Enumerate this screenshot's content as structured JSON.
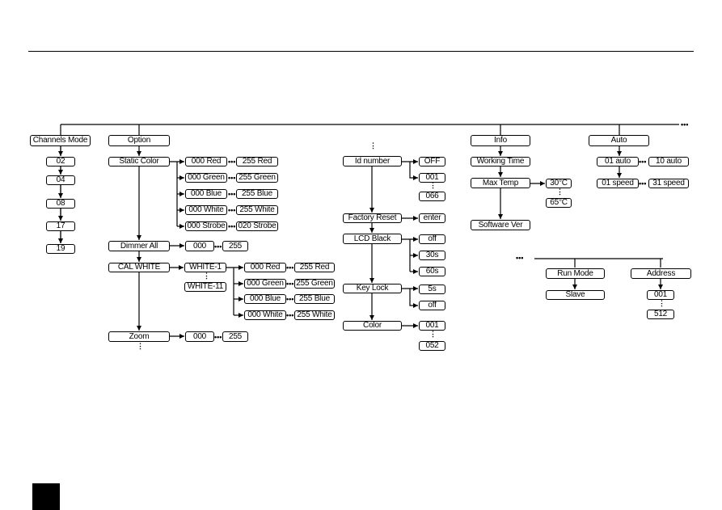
{
  "menu": {
    "channels_mode": {
      "label": "Channels Mode",
      "values": [
        "02",
        "04",
        "08",
        "17",
        "19"
      ]
    },
    "option": {
      "label": "Option",
      "static_color": {
        "label": "Static Color",
        "ranges": [
          [
            "000 Red",
            "255 Red"
          ],
          [
            "000 Green",
            "255 Green"
          ],
          [
            "000 Blue",
            "255 Blue"
          ],
          [
            "000 White",
            "255 White"
          ],
          [
            "000 Strobe",
            "020 Strobe"
          ]
        ]
      },
      "dimmer_all": {
        "label": "Dimmer All",
        "range": [
          "000",
          "255"
        ]
      },
      "cal_white": {
        "label": "CAL WHITE",
        "presets": [
          "WHITE-1",
          "WHITE-11"
        ],
        "ranges": [
          [
            "000 Red",
            "255 Red"
          ],
          [
            "000 Green",
            "255 Green"
          ],
          [
            "000 Blue",
            "255 Blue"
          ],
          [
            "000 White",
            "255 White"
          ]
        ]
      },
      "zoom": {
        "label": "Zoom",
        "range": [
          "000",
          "255"
        ]
      },
      "id_number": {
        "label": "Id number",
        "values": [
          "OFF",
          "001",
          "066"
        ]
      },
      "factory_reset": {
        "label": "Factory Reset",
        "values": [
          "enter"
        ]
      },
      "lcd_black": {
        "label": "LCD Black",
        "values": [
          "off",
          "30s",
          "60s"
        ]
      },
      "key_lock": {
        "label": "Key Lock",
        "values": [
          "5s",
          "off"
        ]
      },
      "color": {
        "label": "Color",
        "values": [
          "001",
          "052"
        ]
      }
    },
    "info": {
      "label": "Info",
      "working_time": "Working Time",
      "max_temp": {
        "label": "Max Temp",
        "values": [
          "30°C",
          "65°C"
        ]
      },
      "software_ver": "Software Ver"
    },
    "auto": {
      "label": "Auto",
      "auto_range": [
        "01 auto",
        "10 auto"
      ],
      "speed_range": [
        "01 speed",
        "31 speed"
      ]
    },
    "run_mode": {
      "label": "Run Mode",
      "values": [
        "Slave"
      ]
    },
    "address": {
      "label": "Address",
      "values": [
        "001",
        "512"
      ]
    }
  },
  "dots": "•••",
  "vdots": "⋮"
}
